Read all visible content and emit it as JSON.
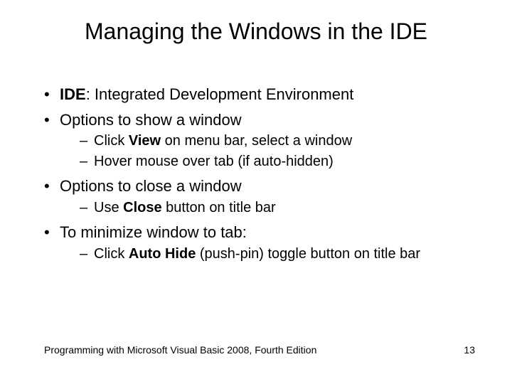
{
  "title": "Managing the Windows in the IDE",
  "bullets": {
    "b1_pre": "",
    "b1_bold": "IDE",
    "b1_post": ": Integrated Development Environment",
    "b2": "Options to show a window",
    "b2_s1_pre": "Click ",
    "b2_s1_bold": "View",
    "b2_s1_post": " on menu bar, select a window",
    "b2_s2": "Hover mouse over tab (if auto-hidden)",
    "b3": "Options to close a window",
    "b3_s1_pre": "Use ",
    "b3_s1_bold": "Close",
    "b3_s1_post": " button on title bar",
    "b4": "To minimize window to tab:",
    "b4_s1_pre": "Click ",
    "b4_s1_bold": "Auto Hide",
    "b4_s1_post": " (push-pin) toggle button on title bar"
  },
  "footer": {
    "left": "Programming with Microsoft Visual Basic 2008, Fourth Edition",
    "right": "13"
  }
}
